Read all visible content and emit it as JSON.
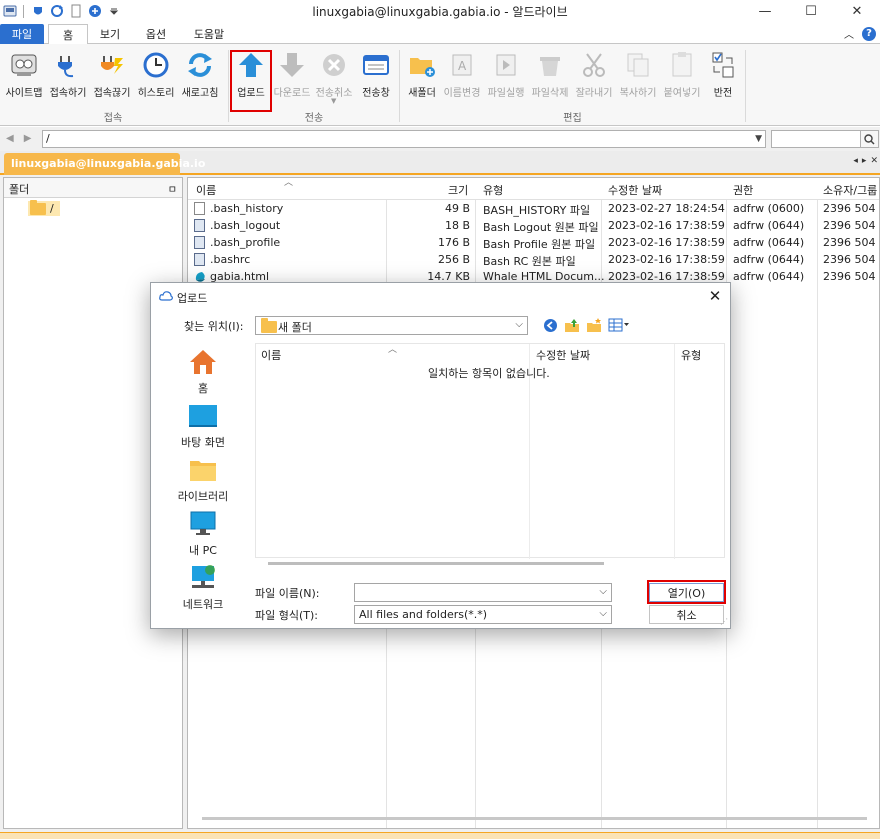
{
  "window": {
    "title": "linuxgabia@linuxgabia.gabia.io - 알드라이브",
    "minimize": "—",
    "maximize": "☐",
    "close": "✕"
  },
  "tabs": {
    "file": "파일",
    "home": "홈",
    "view": "보기",
    "options": "옵션",
    "help": "도움말",
    "help_icon": "?"
  },
  "ribbon": {
    "connect": {
      "label": "접속",
      "buttons": [
        "사이트맵",
        "접속하기",
        "접속끊기",
        "히스토리",
        "새로고침"
      ]
    },
    "transfer": {
      "label": "전송",
      "buttons": [
        "업로드",
        "다운로드",
        "전송취소",
        "전송창"
      ]
    },
    "edit": {
      "label": "편집",
      "buttons": [
        "새폴더",
        "이름변경",
        "파일실행",
        "파일삭제",
        "잘라내기",
        "복사하기",
        "붙여넣기",
        "반전"
      ]
    }
  },
  "address": {
    "path": "/"
  },
  "session": {
    "tab": "linuxgabia@linuxgabia.gabia.io",
    "controls": [
      "◂",
      "▸",
      "✕"
    ]
  },
  "folder_panel": {
    "header": "폴더",
    "pin": "ㅁ",
    "root": "/"
  },
  "file_list": {
    "columns": [
      "이름",
      "크기",
      "유형",
      "수정한 날짜",
      "권한",
      "소유자/그룹"
    ],
    "rows": [
      {
        "name": ".bash_history",
        "size": "49 B",
        "type": "BASH_HISTORY 파일",
        "modified": "2023-02-27 18:24:54",
        "perm": "adfrw (0600)",
        "owner": "2396 504"
      },
      {
        "name": ".bash_logout",
        "size": "18 B",
        "type": "Bash Logout 원본 파일",
        "modified": "2023-02-16 17:38:59",
        "perm": "adfrw (0644)",
        "owner": "2396 504"
      },
      {
        "name": ".bash_profile",
        "size": "176 B",
        "type": "Bash Profile 원본 파일",
        "modified": "2023-02-16 17:38:59",
        "perm": "adfrw (0644)",
        "owner": "2396 504"
      },
      {
        "name": ".bashrc",
        "size": "256 B",
        "type": "Bash RC 원본 파일",
        "modified": "2023-02-16 17:38:59",
        "perm": "adfrw (0644)",
        "owner": "2396 504"
      },
      {
        "name": "gabia.html",
        "size": "14.7 KB",
        "type": "Whale HTML Docum...",
        "modified": "2023-02-16 17:38:59",
        "perm": "adfrw (0644)",
        "owner": "2396 504"
      }
    ]
  },
  "dialog": {
    "title": "업로드",
    "close": "✕",
    "look_in_label": "찾는 위치(I):",
    "look_in_value": "새 폴더",
    "places": [
      "홈",
      "바탕 화면",
      "라이브러리",
      "내 PC",
      "네트워크"
    ],
    "columns": [
      "이름",
      "수정한 날짜",
      "유형"
    ],
    "empty_message": "일치하는 항목이 없습니다.",
    "file_name_label": "파일 이름(N):",
    "file_name_value": "",
    "file_type_label": "파일 형식(T):",
    "file_type_value": "All files and folders(*.*)",
    "open_button": "열기(O)",
    "cancel_button": "취소"
  },
  "colors": {
    "accent": "#2b6fcf",
    "session_tab": "#f7b84b",
    "highlight": "#e00000"
  }
}
